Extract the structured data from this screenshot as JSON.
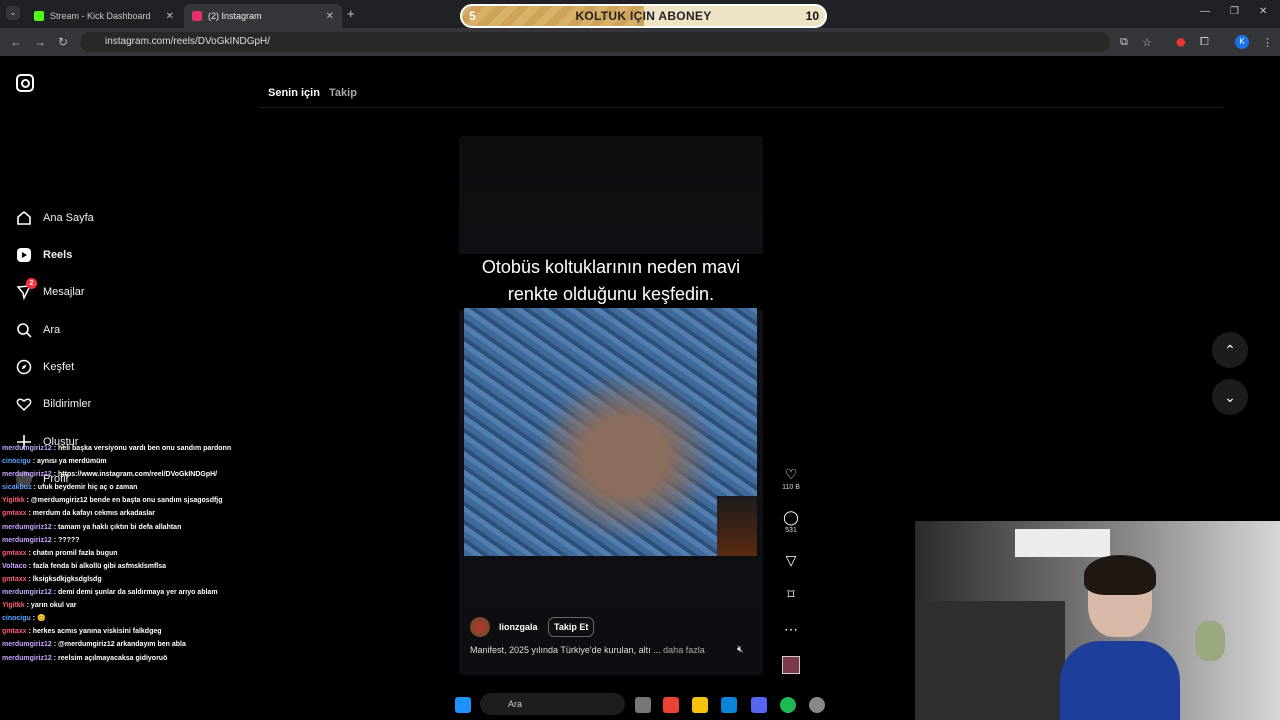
{
  "browser": {
    "tabs": [
      {
        "label": "Stream - Kick Dashboard",
        "color": "#53fc18"
      },
      {
        "label": "(2) Instagram",
        "color": "#e1306c"
      }
    ],
    "url": "instagram.com/reels/DVoGkINDGpH/",
    "profile_initial": "K"
  },
  "overlay": {
    "sub_goal_label": "KOLTUK IÇIN ABONEY",
    "current": "5",
    "target": "10",
    "progress_fraction": 0.5
  },
  "instagram": {
    "nav": [
      {
        "label": "Ana Sayfa",
        "icon": "home-icon"
      },
      {
        "label": "Reels",
        "icon": "reels-icon"
      },
      {
        "label": "Mesajlar",
        "icon": "messages-icon",
        "badge": "2"
      },
      {
        "label": "Ara",
        "icon": "search-icon"
      },
      {
        "label": "Keşfet",
        "icon": "explore-icon"
      },
      {
        "label": "Bildirimler",
        "icon": "heart-icon"
      },
      {
        "label": "Oluştur",
        "icon": "plus-icon"
      },
      {
        "label": "Profil",
        "icon": "profile-icon"
      }
    ],
    "top_tabs": {
      "for_you": "Senin için",
      "following": "Takip"
    },
    "reel": {
      "caption_line1": "Otobüs koltuklarının neden mavi",
      "caption_line2": "renkte olduğunu keşfedin.",
      "username": "lionzgala",
      "follow_label": "Takip Et",
      "description": "Manifest, 2025 yılında Türkiye'de kurulan, altı ...",
      "more_label": "daha fazla"
    },
    "actions": {
      "likes": "110 B",
      "comments": "531"
    }
  },
  "chat": [
    {
      "user": "merdumgiriz12",
      "text": ": heli başka versiyonu vardı ben onu sandım pardonn"
    },
    {
      "user": "cinocigu",
      "text": ": aynısı ya merdümüm"
    },
    {
      "user": "merdumgiriz12",
      "text": ": https://www.instagram.com/reel/DVoGkINDGpH/"
    },
    {
      "user": "sicakbuz",
      "text": ": ufuk beydemir hiç aç o zaman"
    },
    {
      "user": "Yigitkk",
      "text": ": @merdumgiriz12 bende en başta onu sandım sjsagosdfjg"
    },
    {
      "user": "gmtaxx",
      "text": ": merdum da kafayı cekmıs arkadaslar"
    },
    {
      "user": "merdumgiriz12",
      "text": ": tamam ya haklı çıktın bi defa allahtan"
    },
    {
      "user": "merdumgiriz12",
      "text": ": ?????"
    },
    {
      "user": "gmtaxx",
      "text": ": chatın promil fazla bugun"
    },
    {
      "user": "Voltaco",
      "text": ": fazla fenda bi alkollü gibi asfmsklsmflsa"
    },
    {
      "user": "gmtaxx",
      "text": ": lksigksdkjgksdglsdg"
    },
    {
      "user": "merdumgiriz12",
      "text": ": demi demi şunlar da saldırmaya yer arıyo ablam"
    },
    {
      "user": "Yigitkk",
      "text": ": yarın okul var"
    },
    {
      "user": "cinocigu",
      "text": ": 😊"
    },
    {
      "user": "gmtaxx",
      "text": ": herkes acmıs yanına viskisini falkdgeg"
    },
    {
      "user": "merdumgiriz12",
      "text": ": @merdumgiriz12 arkandayım ben abla"
    },
    {
      "user": "merdumgiriz12",
      "text": ": reelsim açılmayacaksa gidiyoruö"
    }
  ],
  "taskbar": {
    "search_label": "Ara"
  }
}
